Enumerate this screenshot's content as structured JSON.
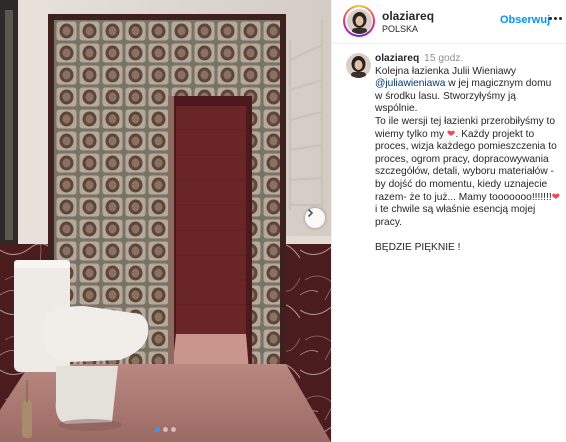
{
  "post": {
    "username": "olaziareq",
    "location": "POLSKA",
    "follow_label": "Obserwuj",
    "caption": {
      "username": "olaziareq",
      "time": "15 godz.",
      "text_1": "Kolejna łazienka Julii Wieniawy ",
      "mention": "@juliawieniawa",
      "text_2": " w jej magicznym domu w środku lasu. Stworzyłyśmy ją wspólnie.\nTo ile wersji tej łazienki przerobiłyśmy to wiemy tylko my ",
      "heart_1": "❤",
      "text_3": ". Każdy projekt to proces, wizja każdego pomieszczenia to proces, ogrom pracy, dopracowywania szczegółów, detali, wyboru materiałów - by dojść do momentu, kiedy uznajecie razem- że to już... Mamy tooooooo!!!!!!!",
      "heart_2": "❤",
      "text_4": "\ni te chwile są właśnie esencją mojej pracy.\n\nBĘDZIE PIĘKNIE !"
    },
    "carousel": {
      "slides": 3,
      "active_index": 0
    },
    "icons": {
      "next": "chevron-right-icon",
      "more": "more-options-icon"
    },
    "colors": {
      "accent": "#0095f6",
      "heart": "#ed4956",
      "active_dot": "#3897f0"
    }
  }
}
